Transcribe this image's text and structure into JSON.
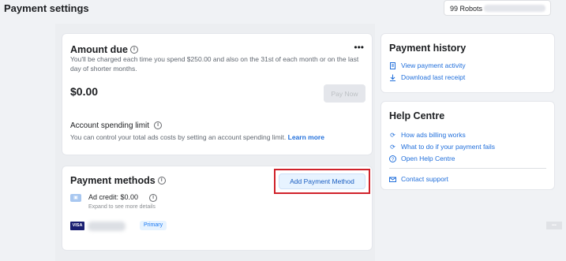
{
  "header": {
    "title": "Payment settings",
    "account_name": "99 Robots"
  },
  "amount_due": {
    "title": "Amount due",
    "description": "You'll be charged each time you spend $250.00 and also on the 31st of each month or on the last day of shorter months.",
    "amount": "$0.00",
    "pay_now_label": "Pay Now",
    "spending_limit_title": "Account spending limit",
    "spending_limit_desc": "You can control your total ads costs by setting an account spending limit.",
    "learn_more": "Learn more"
  },
  "payment_methods": {
    "title": "Payment methods",
    "add_button_label": "Add Payment Method",
    "ad_credit_label": "Ad credit: $0.00",
    "ad_credit_sub": "Expand to see more details",
    "card_brand": "VISA",
    "primary_badge": "Primary"
  },
  "payment_history": {
    "title": "Payment history",
    "links": [
      {
        "label": "View payment activity",
        "icon": "receipt-icon"
      },
      {
        "label": "Download last receipt",
        "icon": "download-icon"
      }
    ]
  },
  "help_centre": {
    "title": "Help Centre",
    "links": [
      {
        "label": "How ads billing works",
        "icon": "refresh-icon"
      },
      {
        "label": "What to do if your payment fails",
        "icon": "refresh-icon"
      },
      {
        "label": "Open Help Centre",
        "icon": "question-icon"
      }
    ],
    "contact_label": "Contact support",
    "contact_icon": "mail-icon"
  },
  "colors": {
    "accent": "#216fdb",
    "highlight_border": "#d0222a",
    "background": "#f0f2f5"
  }
}
